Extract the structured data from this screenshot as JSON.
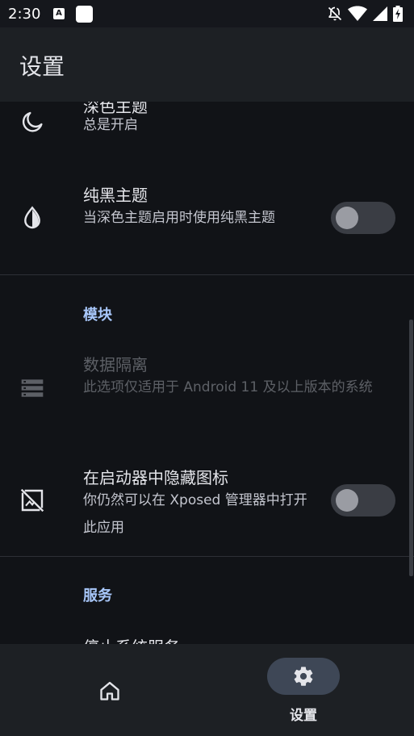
{
  "status_bar": {
    "time": "2:30",
    "notification_a_letter": "A"
  },
  "app_bar": {
    "title": "设置"
  },
  "theme_section": {
    "dark_theme": {
      "title": "深色主题",
      "summary": "总是开启",
      "icon": "moon-icon"
    },
    "black_theme": {
      "title": "纯黑主题",
      "summary": "当深色主题启用时使用纯黑主题",
      "icon": "water-drop-icon",
      "enabled": false
    }
  },
  "module_section": {
    "header": "模块",
    "data_isolation": {
      "title": "数据隔离",
      "summary": "此选项仅适用于 Android 11 及以上版本的系统",
      "icon": "storage-icon",
      "disabled": true
    },
    "hide_icon": {
      "title": "在启动器中隐藏图标",
      "summary": "你仍然可以在 Xposed 管理器中打开此应用",
      "icon": "hide-image-icon",
      "enabled": false
    }
  },
  "service_section": {
    "header": "服务",
    "stop_service_title": "停止系统服务"
  },
  "bottom_nav": {
    "items": [
      {
        "label": "",
        "icon": "home-icon",
        "selected": false
      },
      {
        "label": "设置",
        "icon": "gear-icon",
        "selected": true
      }
    ]
  },
  "colors": {
    "background": "#111317",
    "surface": "#1d2024",
    "accent": "#a8c7fa",
    "nav_indicator": "#3e4756"
  }
}
